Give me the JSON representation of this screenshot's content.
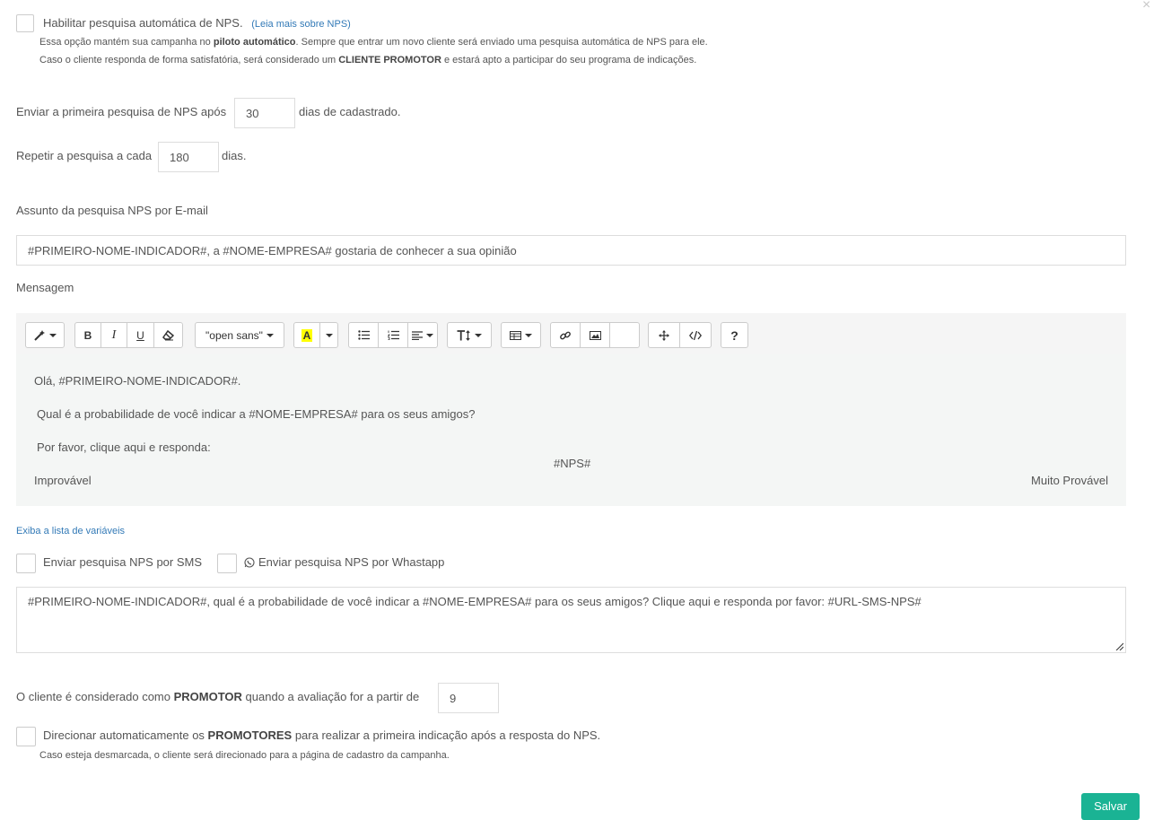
{
  "close_label": "×",
  "auto_nps": {
    "label": "Habilitar pesquisa automática de NPS.",
    "read_more": "(Leia mais sobre NPS)",
    "help_line1_a": "Essa opção mantém sua campanha no ",
    "help_line1_b": "piloto automático",
    "help_line1_c": ". Sempre que entrar um novo cliente será enviado uma pesquisa automática de NPS para ele.",
    "help_line2_a": "Caso o cliente responda de forma satisfatória, será considerado um ",
    "help_line2_b": "CLIENTE PROMOTOR",
    "help_line2_c": " e estará apto a participar do seu programa de indicações."
  },
  "first_survey": {
    "label_before": "Enviar a primeira pesquisa de NPS após",
    "value": "30",
    "label_after": "dias de cadastrado."
  },
  "repeat_survey": {
    "label_before": "Repetir a pesquisa a cada",
    "value": "180",
    "label_after": "dias."
  },
  "subject": {
    "label": "Assunto da pesquisa NPS por E-mail",
    "value": "#PRIMEIRO-NOME-INDICADOR#, a #NOME-EMPRESA# gostaria de conhecer a sua opinião"
  },
  "message": {
    "label": "Mensagem",
    "font_name": "\"open sans\"",
    "line1": "Olá, #PRIMEIRO-NOME-INDICADOR#.",
    "line2": "Qual é a probabilidade de você indicar a #NOME-EMPRESA# para os seus amigos?",
    "line3": "Por favor, clique aqui e responda:",
    "nps_tag": "#NPS#",
    "scale_left": "Improvável",
    "scale_right": "Muito Provável"
  },
  "variables_link": "Exiba a lista de variáveis",
  "sms": {
    "label": "Enviar pesquisa NPS por SMS"
  },
  "whatsapp": {
    "label": "Enviar pesquisa NPS por Whastapp"
  },
  "sms_message": "#PRIMEIRO-NOME-INDICADOR#, qual é a probabilidade de você indicar a #NOME-EMPRESA# para os seus amigos? Clique aqui e responda por favor: #URL-SMS-NPS#",
  "promoter": {
    "label_a": "O cliente é considerado como ",
    "label_b": "PROMOTOR",
    "label_c": " quando a avaliação for a partir de",
    "value": "9"
  },
  "redirect": {
    "label_a": "Direcionar automaticamente os ",
    "label_b": "PROMOTORES",
    "label_c": " para realizar a primeira indicação após a resposta do NPS.",
    "help": "Caso esteja desmarcada, o cliente será direcionado para a página de cadastro da campanha."
  },
  "save_label": "Salvar",
  "colors": {
    "accent": "#1ab394",
    "link": "#337ab7",
    "editor_bg": "#f4f6f5",
    "highlight": "#ffff00"
  }
}
